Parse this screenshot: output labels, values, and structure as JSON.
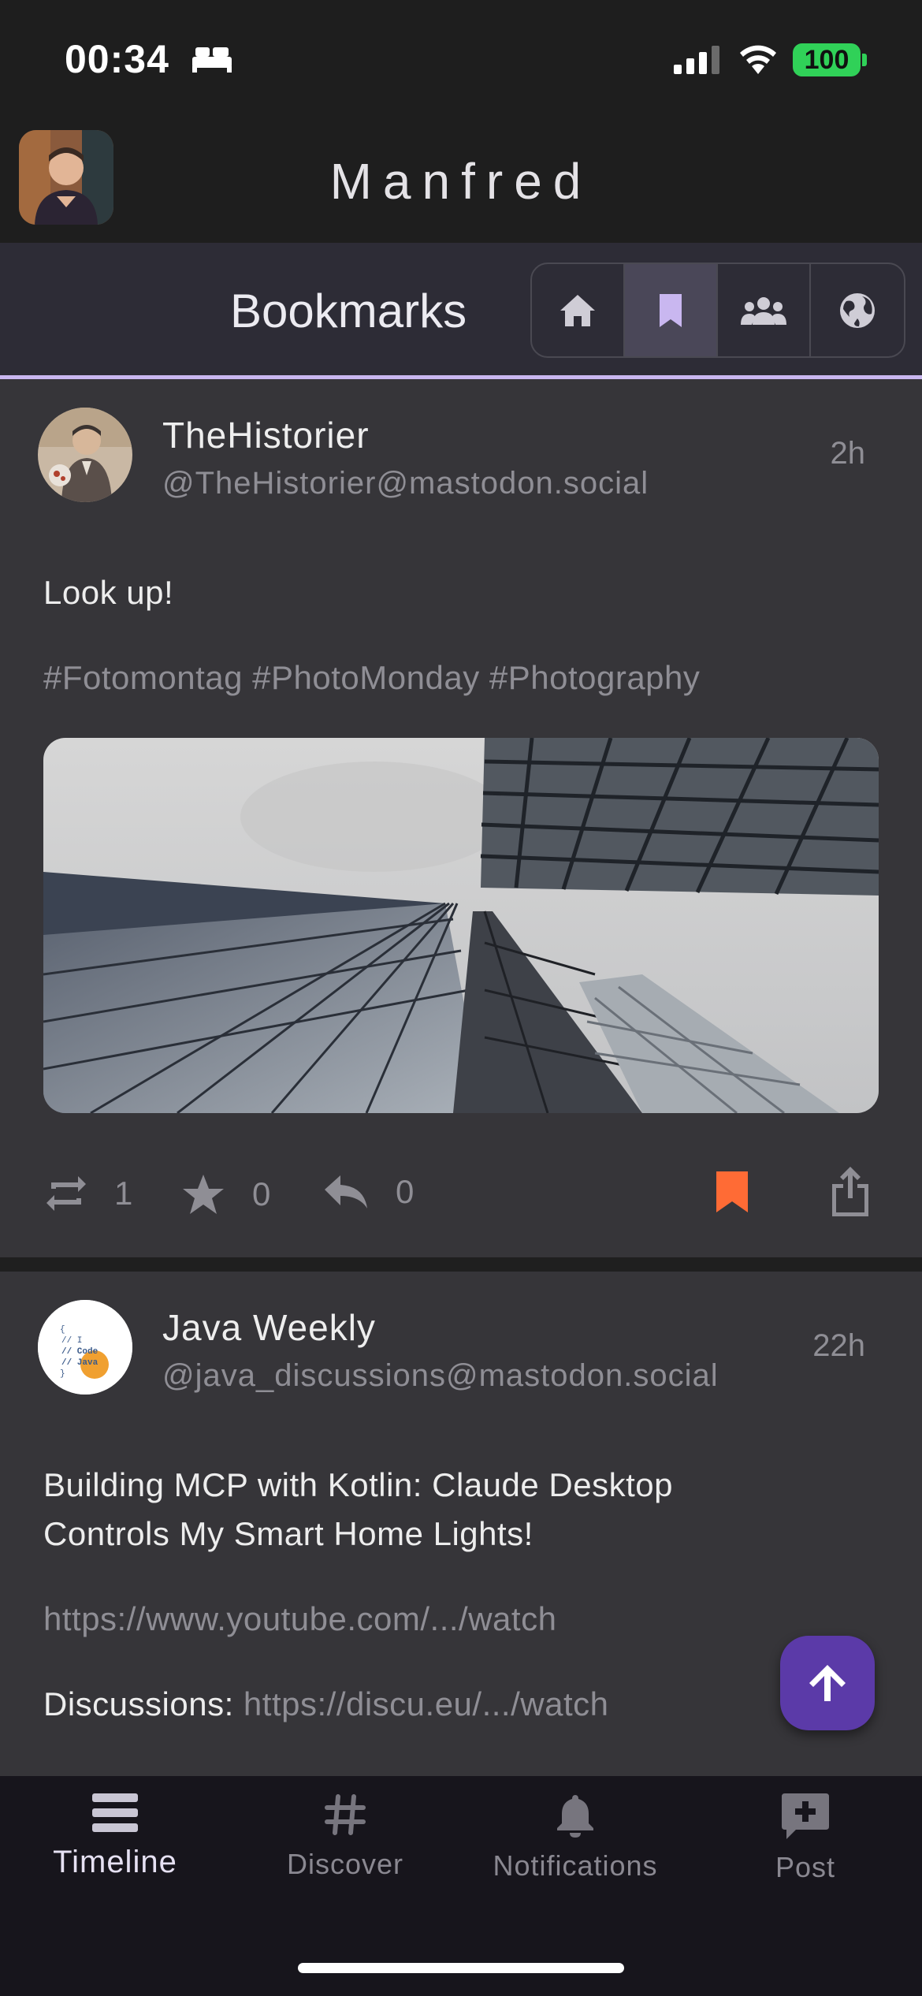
{
  "status_bar": {
    "time": "00:34",
    "battery": "100"
  },
  "header": {
    "account_name": "Manfred"
  },
  "subheader": {
    "title": "Bookmarks",
    "segments": [
      {
        "icon": "home-icon",
        "active": false
      },
      {
        "icon": "bookmark-icon",
        "active": true
      },
      {
        "icon": "group-icon",
        "active": false
      },
      {
        "icon": "globe-icon",
        "active": false
      }
    ]
  },
  "posts": [
    {
      "display_name": "TheHistorier",
      "handle": "@TheHistorier@mastodon.social",
      "time": "2h",
      "text": "Look up!",
      "hashtags": "#Fotomontag #PhotoMonday #Photography",
      "boosts": "1",
      "favourites": "0",
      "replies": "0",
      "bookmarked": true
    },
    {
      "display_name": "Java Weekly",
      "handle": "@java_discussions@mastodon.social",
      "time": "22h",
      "text_line1": "Building MCP with Kotlin: Claude Desktop",
      "text_line2": "Controls My Smart Home Lights!",
      "link": "https://www.youtube.com/.../watch",
      "discussions_label": "Discussions:",
      "discussions_link": "https://discu.eu/.../watch",
      "avatar_text": "{ // I // Code // Java }"
    }
  ],
  "tabs": [
    {
      "label": "Timeline",
      "active": true
    },
    {
      "label": "Discover",
      "active": false
    },
    {
      "label": "Notifications",
      "active": false
    },
    {
      "label": "Post",
      "active": false
    }
  ],
  "colors": {
    "accent": "#5b3aa8",
    "bookmark_active": "#ff6b35",
    "highlight_line": "#c9b7f0"
  }
}
